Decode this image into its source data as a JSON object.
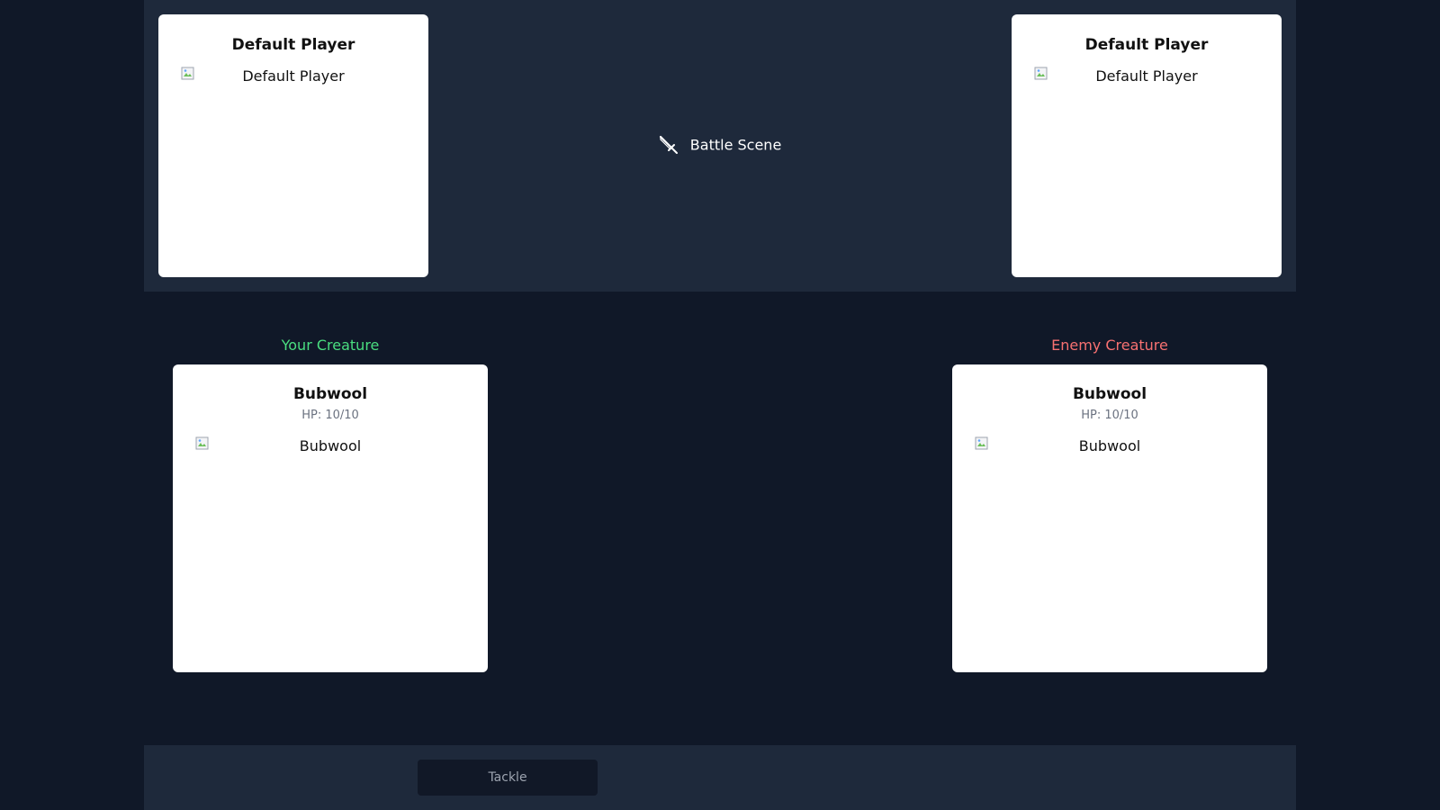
{
  "players": {
    "left": {
      "name": "Default Player",
      "image_alt": "Default Player"
    },
    "right": {
      "name": "Default Player",
      "image_alt": "Default Player"
    }
  },
  "battle_scene": {
    "label": "Battle Scene",
    "icon": "sword-icon"
  },
  "your_creature": {
    "heading": "Your Creature",
    "name": "Bubwool",
    "hp": "HP: 10/10",
    "image_alt": "Bubwool"
  },
  "enemy_creature": {
    "heading": "Enemy Creature",
    "name": "Bubwool",
    "hp": "HP: 10/10",
    "image_alt": "Bubwool"
  },
  "moves": [
    {
      "label": "Tackle"
    }
  ],
  "colors": {
    "background": "#101828",
    "panel": "#1e293b",
    "your_heading": "#4ade80",
    "enemy_heading": "#f87171"
  }
}
